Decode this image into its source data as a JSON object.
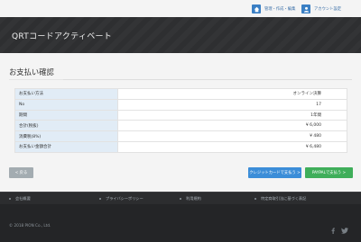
{
  "topnav": {
    "manage_label": "管理・作成・編集",
    "account_label": "アカウント設定",
    "icons": [
      "home-icon",
      "user-icon"
    ],
    "accent_color": "#3a7fc4"
  },
  "header": {
    "title": "QRTコードアクティベート"
  },
  "page": {
    "section_title": "お支払い確認"
  },
  "summary_table": {
    "rows": [
      {
        "label": "お支払い方法",
        "value": "オンライン決算"
      },
      {
        "label": "No",
        "value": "17"
      },
      {
        "label": "期間",
        "value": "1年間"
      },
      {
        "label": "合計(税抜)",
        "value": "¥ 6,000"
      },
      {
        "label": "消費税(8%)",
        "value": "¥ 480"
      },
      {
        "label": "お支払い金額合計",
        "value": "¥ 6,480"
      }
    ]
  },
  "actions": {
    "back_label": "< 戻る",
    "credit_label": "クレジットカードで支払う >",
    "paypal_label": "PAYPALで支払う >",
    "colors": {
      "back": "#a3acb1",
      "credit": "#3b8dd8",
      "paypal": "#3fae5a"
    }
  },
  "footer": {
    "links": [
      "会社概要",
      "プライバシーポリシー",
      "利用規約",
      "特定商取引法に基づく表記"
    ],
    "copyright": "© 2018 PION Co., Ltd.",
    "social_icons": [
      "facebook-icon",
      "twitter-icon"
    ]
  }
}
